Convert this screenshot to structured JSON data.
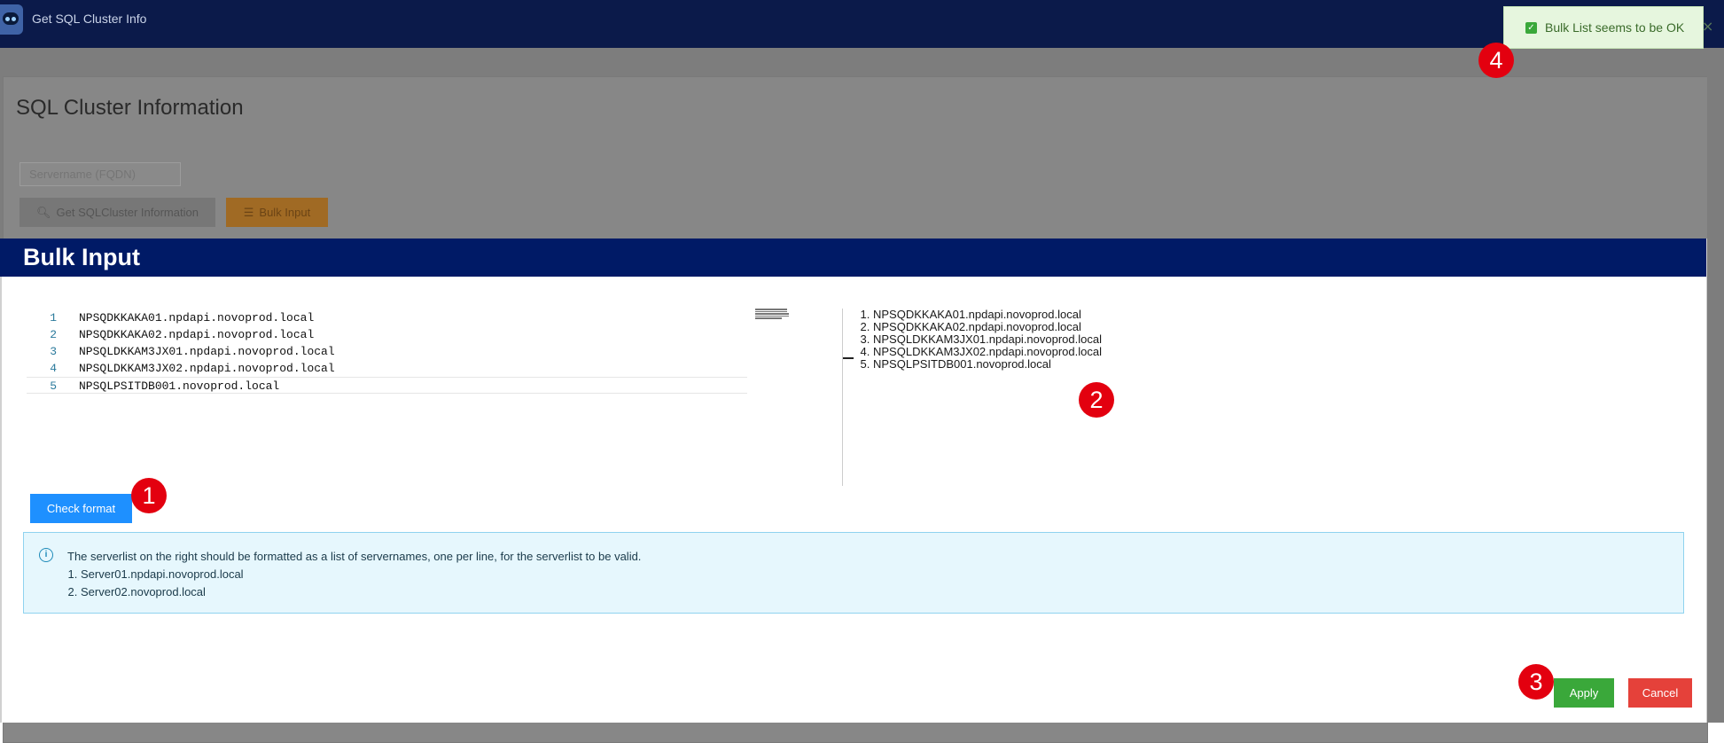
{
  "app": {
    "title": "Get SQL Cluster Info"
  },
  "page": {
    "title": "SQL Cluster Information",
    "server_placeholder": "Servername (FQDN)",
    "get_button": "Get SQLCluster Information",
    "bulk_button": "Bulk Input"
  },
  "modal": {
    "title": "Bulk Input",
    "editor_lines": [
      "NPSQDKKAKA01.npdapi.novoprod.local",
      "NPSQDKKAKA02.npdapi.novoprod.local",
      "NPSQLDKKAM3JX01.npdapi.novoprod.local",
      "NPSQLDKKAM3JX02.npdapi.novoprod.local",
      "NPSQLPSITDB001.novoprod.local"
    ],
    "line_numbers": [
      "1",
      "2",
      "3",
      "4",
      "5"
    ],
    "preview_items": [
      "NPSQDKKAKA01.npdapi.novoprod.local",
      "NPSQDKKAKA02.npdapi.novoprod.local",
      "NPSQLDKKAM3JX01.npdapi.novoprod.local",
      "NPSQLDKKAM3JX02.npdapi.novoprod.local",
      "NPSQLPSITDB001.novoprod.local"
    ],
    "check_button": "Check format",
    "info": {
      "text": "The serverlist on the right should be formatted as a list of servernames, one per line, for the serverlist to be valid.",
      "examples": [
        "Server01.npdapi.novoprod.local",
        "Server02.novoprod.local"
      ]
    },
    "apply_button": "Apply",
    "cancel_button": "Cancel"
  },
  "toast": {
    "text": "Bulk List seems to be OK",
    "close": "×"
  },
  "markers": [
    "1",
    "2",
    "3",
    "4"
  ],
  "colors": {
    "topbar": "#0b1a4a",
    "modal_header": "#001a66",
    "primary": "#1e90ff",
    "success": "#3aa83a",
    "danger": "#e5413a",
    "marker": "#e3000f"
  }
}
